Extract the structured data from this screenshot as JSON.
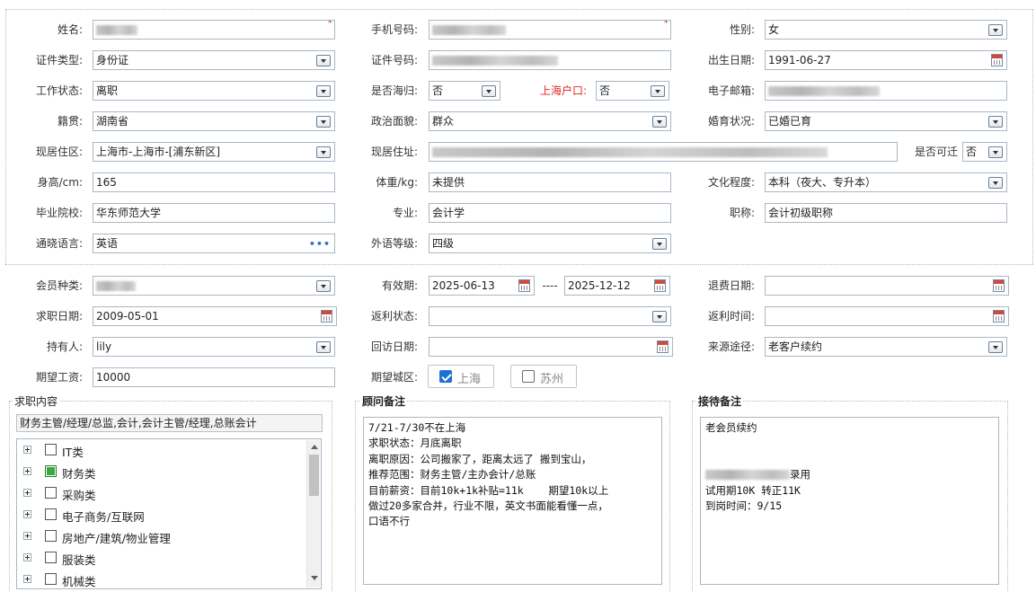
{
  "basic": {
    "name": {
      "label": "姓名:",
      "value_redacted": true,
      "required_mark": "*"
    },
    "phone": {
      "label": "手机号码:",
      "value_redacted": true,
      "required_mark": "*"
    },
    "gender": {
      "label": "性别:",
      "value": "女"
    },
    "id_type": {
      "label": "证件类型:",
      "value": "身份证"
    },
    "id_number": {
      "label": "证件号码:",
      "value_redacted": true
    },
    "birth_date": {
      "label": "出生日期:",
      "value": "1991-06-27"
    },
    "work_status": {
      "label": "工作状态:",
      "value": "离职"
    },
    "returnee": {
      "label": "是否海归:",
      "value": "否"
    },
    "shanghai_hukou": {
      "label": "上海户口:",
      "value": "否"
    },
    "email": {
      "label": "电子邮箱:",
      "value_redacted": true
    },
    "native_place": {
      "label": "籍贯:",
      "value": "湖南省"
    },
    "political_status": {
      "label": "政治面貌:",
      "value": "群众"
    },
    "marital_status": {
      "label": "婚育状况:",
      "value": "已婚已育"
    },
    "current_area": {
      "label": "现居住区:",
      "value": "上海市-上海市-[浦东新区]"
    },
    "current_address": {
      "label": "现居住址:",
      "value_redacted": true
    },
    "relocatable": {
      "label": "是否可迁",
      "value": "否"
    },
    "height": {
      "label": "身高/cm:",
      "value": "165"
    },
    "weight": {
      "label": "体重/kg:",
      "value": "未提供"
    },
    "education": {
      "label": "文化程度:",
      "value": "本科（夜大、专升本）"
    },
    "school": {
      "label": "毕业院校:",
      "value": "华东师范大学"
    },
    "major": {
      "label": "专业:",
      "value": "会计学"
    },
    "title": {
      "label": "职称:",
      "value": "会计初级职称"
    },
    "language": {
      "label": "通晓语言:",
      "value": "英语",
      "more": "•••"
    },
    "foreign_level": {
      "label": "外语等级:",
      "value": "四级"
    }
  },
  "membership": {
    "member_type": {
      "label": "会员种类:",
      "value_redacted": true
    },
    "validity": {
      "label": "有效期:",
      "from": "2025-06-13",
      "sep": "----",
      "to": "2025-12-12"
    },
    "refund_date": {
      "label": "退费日期:",
      "value": ""
    },
    "job_date": {
      "label": "求职日期:",
      "value": "2009-05-01"
    },
    "rebate_status": {
      "label": "返利状态:",
      "value": ""
    },
    "rebate_time": {
      "label": "返利时间:",
      "value": ""
    },
    "holder": {
      "label": "持有人:",
      "value": "lily"
    },
    "visit_date": {
      "label": "回访日期:",
      "value": ""
    },
    "source": {
      "label": "来源途径:",
      "value": "老客户续约"
    },
    "salary": {
      "label": "期望工资:",
      "value": "10000"
    },
    "city": {
      "label": "期望城区:",
      "options": [
        {
          "label": "上海",
          "checked": true
        },
        {
          "label": "苏州",
          "checked": false
        }
      ]
    }
  },
  "job_content": {
    "title": "求职内容",
    "summary": "财务主管/经理/总监,会计,会计主管/经理,总账会计",
    "tree": [
      {
        "label": "IT类",
        "state": "unchecked"
      },
      {
        "label": "财务类",
        "state": "partial"
      },
      {
        "label": "采购类",
        "state": "unchecked"
      },
      {
        "label": "电子商务/互联网",
        "state": "unchecked"
      },
      {
        "label": "房地产/建筑/物业管理",
        "state": "unchecked"
      },
      {
        "label": "服装类",
        "state": "unchecked"
      },
      {
        "label": "机械类",
        "state": "unchecked"
      }
    ]
  },
  "advisor_notes": {
    "title": "顾问备注",
    "lines": [
      "",
      "7/21-7/30不在上海",
      "",
      "求职状态：月底离职",
      "离职原因：公司搬家了，距离太远了 搬到宝山，",
      "推荐范围：财务主管/主办会计/总账",
      "目前薪资：目前10k+1k补贴=11k    期望10k以上",
      "",
      "做过20多家合并，行业不限，英文书面能看懂一点，",
      "口语不行"
    ]
  },
  "reception_notes": {
    "title": "接待备注",
    "line1": "老会员续约",
    "line2_suffix": "录用",
    "line3": "试用期10K 转正11K",
    "line4": "到岗时间：9/15"
  }
}
